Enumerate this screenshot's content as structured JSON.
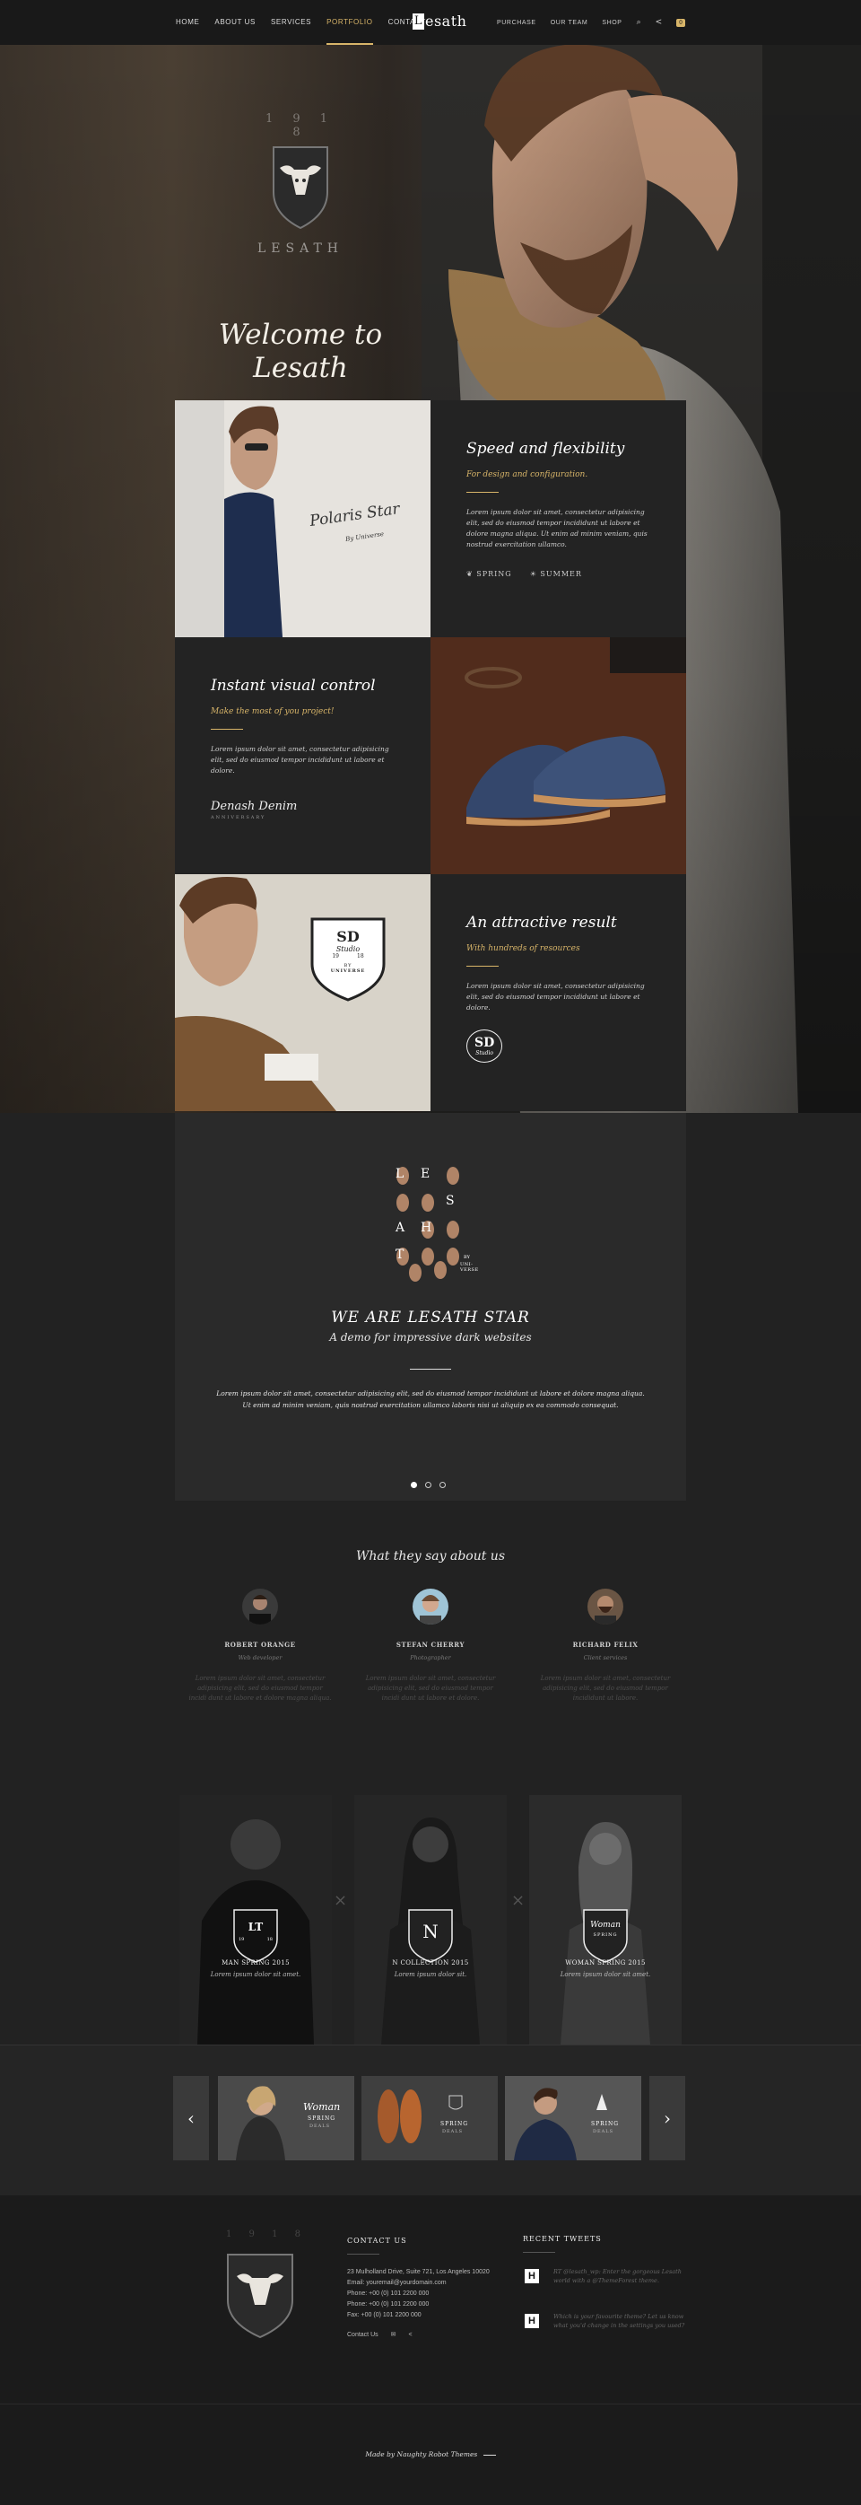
{
  "nav": {
    "left": [
      "HOME",
      "ABOUT US",
      "SERVICES",
      "PORTFOLIO",
      "CONTACT"
    ],
    "active_index": 3,
    "logo_letter": "L",
    "logo_rest": "esath",
    "right": [
      "PURCHASE",
      "OUR TEAM",
      "SHOP"
    ],
    "cart_count": "0"
  },
  "hero": {
    "est_text": "1 9 1 8",
    "brand": "LESATH",
    "title_line1": "Welcome to",
    "title_line2": "Lesath"
  },
  "features": {
    "f1": {
      "title": "Speed and flexibility",
      "subtitle": "For design and configuration.",
      "text": "Lorem ipsum dolor sit amet, consectetur adipisicing elit, sed do eiusmod tempor incididunt ut labore et dolore magna aliqua. Ut enim ad minim veniam, quis nostrud exercitation ullamco.",
      "badge1": "SPRING",
      "badge2": "SUMMER"
    },
    "polaris": {
      "title": "Polaris Star",
      "by": "By Universe"
    },
    "f2": {
      "title": "Instant visual control",
      "subtitle": "Make the most of you project!",
      "text": "Lorem ipsum dolor sit amet, consectetur adipisicing elit, sed do eiusmod tempor incididunt ut labore et dolore.",
      "signature": "Denash Denim",
      "signature_sub": "ANNIVERSARY"
    },
    "f3": {
      "title": "An attractive result",
      "subtitle": "With hundreds of resources",
      "text": "Lorem ipsum dolor sit amet, consectetur adipisicing elit, sed do eiusmod tempor incididunt ut labore et dolore.",
      "logo": "SD",
      "logo_sub": "Studio"
    },
    "sd_badge": {
      "mark": "SD",
      "script": "Studio",
      "years_left": "19",
      "years_right": "18",
      "by": "BY",
      "maker": "UNIVERSE"
    }
  },
  "star": {
    "letters": [
      "L",
      "E",
      "S",
      "A",
      "T",
      "H"
    ],
    "by": "BY",
    "maker": "UNI-VERSE",
    "title": "WE ARE LESATH STAR",
    "subtitle": "A demo for impressive dark websites",
    "para1": "Lorem ipsum dolor sit amet, consectetur adipisicing elit, sed do eiusmod tempor incididunt ut labore et dolore magna aliqua.",
    "para2": "Ut enim ad minim veniam, quis nostrud exercitation ullamco laboris nisi ut aliquip ex ea commodo consequat."
  },
  "testimonials": {
    "title": "What they say about us",
    "items": [
      {
        "name": "ROBERT ORANGE",
        "role": "Web developer",
        "text": "Lorem ipsum dolor sit amet, consectetur adipisicing elit, sed do eiusmod tempor incidi dunt ut labore et dolore magna aliqua."
      },
      {
        "name": "STEFAN CHERRY",
        "role": "Photographer",
        "text": "Lorem ipsum dolor sit amet, consectetur adipisicing elit, sed do eiusmod tempor incidi dunt ut labore et dolore."
      },
      {
        "name": "RICHARD FELIX",
        "role": "Client services",
        "text": "Lorem ipsum dolor sit amet, consectetur adipisicing elit, sed do eiusmod tempor incididunt ut labore."
      }
    ]
  },
  "collections": [
    {
      "badge": "LT",
      "badge_top": "19",
      "badge_bottom": "18",
      "title": "MAN SPRING 2015",
      "text": "Lorem ipsum dolor sit amet."
    },
    {
      "badge": "N",
      "title": "N COLLECTION 2015",
      "text": "Lorem ipsum dolor sit."
    },
    {
      "badge": "Woman",
      "badge_sub": "SPRING",
      "title": "WOMAN SPRING 2015",
      "text": "Lorem ipsum dolor sit amet."
    }
  ],
  "carousel": {
    "prev": "‹",
    "next": "›",
    "items": [
      {
        "title": "Woman",
        "line1": "SPRING",
        "line2": "DEALS"
      },
      {
        "title": "",
        "line1": "SPRING",
        "line2": "DEALS"
      },
      {
        "title": "",
        "line1": "SPRING",
        "line2": "DEALS"
      }
    ]
  },
  "footer": {
    "est": "1 9 1 8",
    "contact_title": "CONTACT US",
    "address": "23 Mulholland Drive, Suite 721, Los Angeles 10020",
    "email": "Email: youremail@yourdomain.com",
    "phone1": "Phone: +00 (0) 101 2200 000",
    "phone2": "Phone: +00 (0) 101 2200 000",
    "fax": "Fax: +00 (0) 101 2200 000",
    "contact_link": "Contact Us",
    "tweets_title": "RECENT TWEETS",
    "tweet1": "RT @lesath_wp: Enter the gorgeous Lesath world with a @ThemeForest theme.",
    "tweet2": "Which is your favourite theme? Let us know what you'd change in the settings you used?",
    "made": "Made by Naughty Robot Themes",
    "colors": {
      "accent": "#d8b569"
    }
  }
}
